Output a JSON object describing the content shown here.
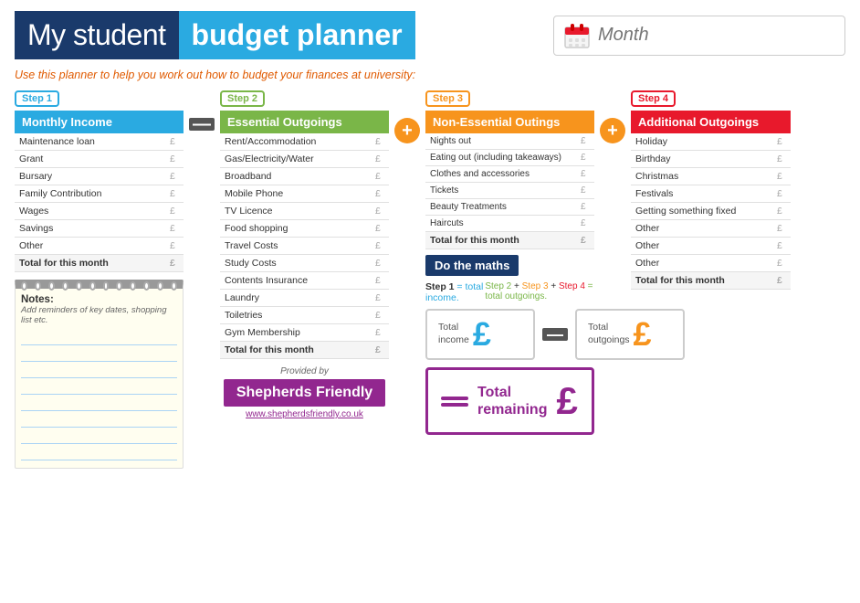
{
  "header": {
    "title_prefix": "My student ",
    "title_main": "budget planner",
    "month_placeholder": "Month"
  },
  "subtitle": "Use this planner to help you work out how to budget your finances at university:",
  "step1": {
    "label": "Step 1",
    "header": "Monthly Income",
    "rows": [
      {
        "name": "Maintenance loan",
        "value": "£"
      },
      {
        "name": "Grant",
        "value": "£"
      },
      {
        "name": "Bursary",
        "value": "£"
      },
      {
        "name": "Family Contribution",
        "value": "£"
      },
      {
        "name": "Wages",
        "value": "£"
      },
      {
        "name": "Savings",
        "value": "£"
      },
      {
        "name": "Other",
        "value": "£"
      }
    ],
    "total_label": "Total for this month",
    "total_value": "£"
  },
  "step2": {
    "label": "Step 2",
    "header": "Essential Outgoings",
    "rows": [
      {
        "name": "Rent/Accommodation",
        "value": "£"
      },
      {
        "name": "Gas/Electricity/Water",
        "value": "£"
      },
      {
        "name": "Broadband",
        "value": "£"
      },
      {
        "name": "Mobile Phone",
        "value": "£"
      },
      {
        "name": "TV Licence",
        "value": "£"
      },
      {
        "name": "Food shopping",
        "value": "£"
      },
      {
        "name": "Travel Costs",
        "value": "£"
      },
      {
        "name": "Study Costs",
        "value": "£"
      },
      {
        "name": "Contents Insurance",
        "value": "£"
      },
      {
        "name": "Laundry",
        "value": "£"
      },
      {
        "name": "Toiletries",
        "value": "£"
      },
      {
        "name": "Gym Membership",
        "value": "£"
      }
    ],
    "total_label": "Total for this month",
    "total_value": "£",
    "provided_by": "Provided by",
    "brand_name": "Shepherds Friendly",
    "brand_url": "www.shepherdsfriendly.co.uk"
  },
  "step3": {
    "label": "Step 3",
    "header": "Non-Essential Outings",
    "rows": [
      {
        "name": "Nights out",
        "value": "£"
      },
      {
        "name": "Eating out (including takeaways)",
        "value": "£"
      },
      {
        "name": "Clothes and accessories",
        "value": "£"
      },
      {
        "name": "Tickets",
        "value": "£"
      },
      {
        "name": "Beauty Treatments",
        "value": "£"
      },
      {
        "name": "Haircuts",
        "value": "£"
      }
    ],
    "total_label": "Total for this month",
    "total_value": "£"
  },
  "step4": {
    "label": "Step 4",
    "header": "Additional Outgoings",
    "rows": [
      {
        "name": "Holiday",
        "value": "£"
      },
      {
        "name": "Birthday",
        "value": "£"
      },
      {
        "name": "Christmas",
        "value": "£"
      },
      {
        "name": "Festivals",
        "value": "£"
      },
      {
        "name": "Getting something fixed",
        "value": "£"
      },
      {
        "name": "Other",
        "value": "£"
      },
      {
        "name": "Other",
        "value": "£"
      },
      {
        "name": "Other",
        "value": "£"
      }
    ],
    "total_label": "Total for this month",
    "total_value": "£"
  },
  "notes": {
    "title": "Notes:",
    "subtitle": "Add reminders of key dates, shopping list etc."
  },
  "maths": {
    "header": "Do the maths",
    "step1_text": "Step 1",
    "step1_suffix": " = total income.",
    "step2_text": "Step 2",
    "step3_text": "Step 3",
    "step4_text": "Step 4",
    "outgoings_suffix": " = total outgoings.",
    "total_income_label": "Total\nincome",
    "total_outgoings_label": "Total\noutgoings",
    "total_remaining_label": "Total\nremaining"
  }
}
